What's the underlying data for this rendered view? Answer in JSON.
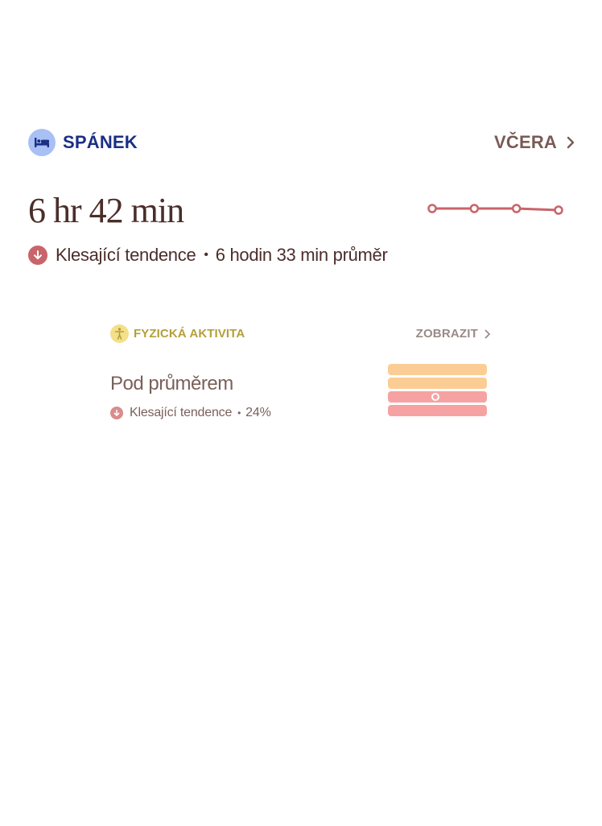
{
  "sleep": {
    "title": "SPÁNEK",
    "icon": "bed-icon",
    "period_label": "VČERA",
    "value": "6 hr 42 min",
    "trend_text": "Klesající tendence",
    "average_text": "6 hodin 33 min průměr",
    "sparkline": [
      6.7,
      6.7,
      6.7,
      6.6
    ],
    "colors": {
      "icon_bg": "#a9c0f5",
      "title": "#1b2f86",
      "trend": "#c9646a",
      "line": "#c9646a"
    }
  },
  "activity": {
    "title": "FYZICKÁ AKTIVITA",
    "icon": "person-activity-icon",
    "link_label": "ZOBRAZIT",
    "status": "Pod průměrem",
    "trend_text": "Klesající tendence",
    "trend_value": "24%",
    "levels": [
      {
        "color": "#fbcd95"
      },
      {
        "color": "#fbcd95"
      },
      {
        "color": "#f7a2a2"
      },
      {
        "color": "#f7a2a2"
      }
    ],
    "current_level_index": 2,
    "colors": {
      "icon_bg": "#f4e08a",
      "title": "#b3a03a",
      "trend": "#d98c8c"
    }
  }
}
